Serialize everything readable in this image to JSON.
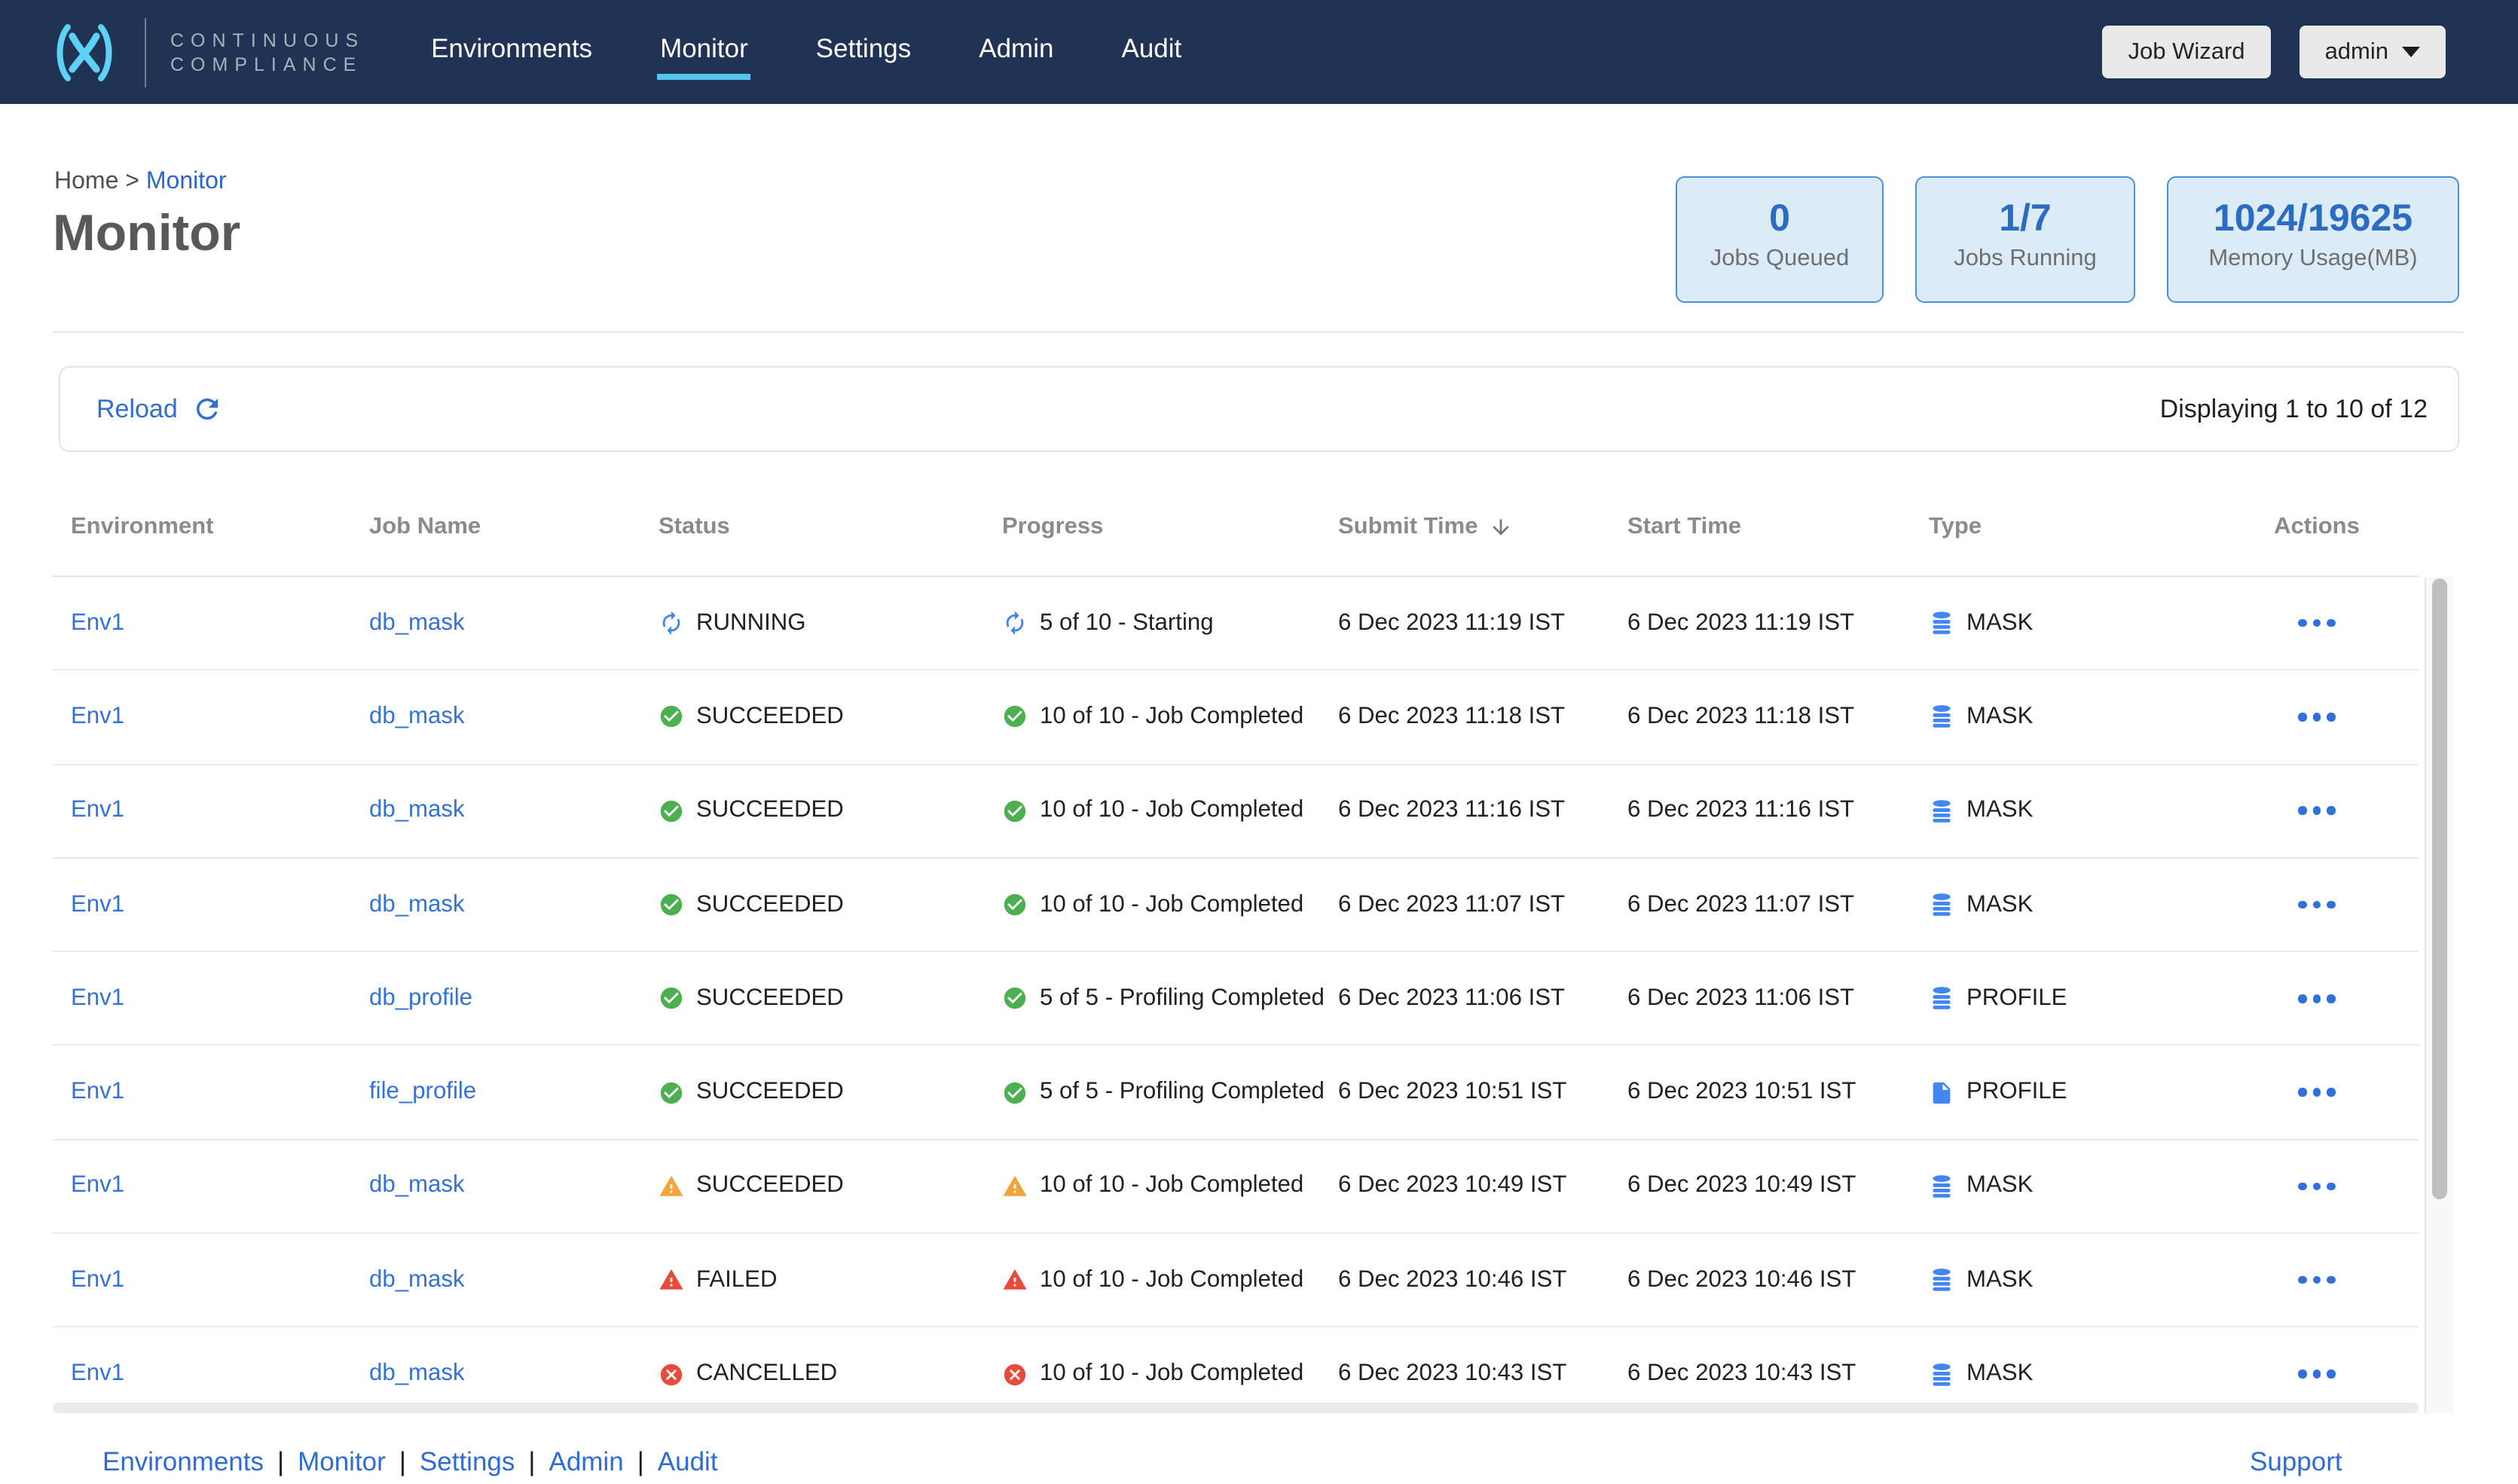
{
  "colors": {
    "header_bg": "#203354",
    "nav_active_underline": "#55c6e9",
    "logo_blue": "#5ed2f5",
    "link_blue": "#2f6fd4",
    "running_blue": "#4285f4",
    "success_green": "#4caf50",
    "warning_orange": "#f2a33c",
    "error_red": "#e84b3c",
    "type_icon_blue": "#4285f4",
    "sort_arrow_gray": "#757575"
  },
  "header": {
    "brand_line1": "CONTINUOUS",
    "brand_line2": "COMPLIANCE",
    "nav": [
      {
        "label": "Environments",
        "active": false
      },
      {
        "label": "Monitor",
        "active": true
      },
      {
        "label": "Settings",
        "active": false
      },
      {
        "label": "Admin",
        "active": false
      },
      {
        "label": "Audit",
        "active": false
      }
    ],
    "job_wizard_label": "Job Wizard",
    "user_menu_label": "admin"
  },
  "breadcrumb": {
    "home": "Home",
    "separator": ">",
    "current": "Monitor"
  },
  "page_title": "Monitor",
  "stats": [
    {
      "value": "0",
      "label": "Jobs Queued",
      "width": 138
    },
    {
      "value": "1/7",
      "label": "Jobs Running",
      "width": 146
    },
    {
      "value": "1024/19625",
      "label": "Memory Usage(MB)",
      "width": 194
    }
  ],
  "toolbar": {
    "reload_label": "Reload",
    "displaying_text": "Displaying 1 to 10 of 12"
  },
  "table": {
    "columns": [
      {
        "label": "Environment"
      },
      {
        "label": "Job Name"
      },
      {
        "label": "Status"
      },
      {
        "label": "Progress"
      },
      {
        "label": "Submit Time",
        "sorted": "desc"
      },
      {
        "label": "Start Time"
      },
      {
        "label": "Type"
      },
      {
        "label": "Actions",
        "center": true
      }
    ],
    "rows": [
      {
        "environment": "Env1",
        "job_name": "db_mask",
        "status": {
          "icon": "running-spinner-icon",
          "label": "RUNNING"
        },
        "progress": {
          "icon": "running-spinner-icon",
          "label": "5 of 10 - Starting"
        },
        "submit_time": "6 Dec 2023 11:19 IST",
        "start_time": "6 Dec 2023 11:19 IST",
        "type": {
          "icon": "database-icon",
          "label": "MASK"
        }
      },
      {
        "environment": "Env1",
        "job_name": "db_mask",
        "status": {
          "icon": "success-check-icon",
          "label": "SUCCEEDED"
        },
        "progress": {
          "icon": "success-check-icon",
          "label": "10 of 10 - Job Completed"
        },
        "submit_time": "6 Dec 2023 11:18 IST",
        "start_time": "6 Dec 2023 11:18 IST",
        "type": {
          "icon": "database-icon",
          "label": "MASK"
        }
      },
      {
        "environment": "Env1",
        "job_name": "db_mask",
        "status": {
          "icon": "success-check-icon",
          "label": "SUCCEEDED"
        },
        "progress": {
          "icon": "success-check-icon",
          "label": "10 of 10 - Job Completed"
        },
        "submit_time": "6 Dec 2023 11:16 IST",
        "start_time": "6 Dec 2023 11:16 IST",
        "type": {
          "icon": "database-icon",
          "label": "MASK"
        }
      },
      {
        "environment": "Env1",
        "job_name": "db_mask",
        "status": {
          "icon": "success-check-icon",
          "label": "SUCCEEDED"
        },
        "progress": {
          "icon": "success-check-icon",
          "label": "10 of 10 - Job Completed"
        },
        "submit_time": "6 Dec 2023 11:07 IST",
        "start_time": "6 Dec 2023 11:07 IST",
        "type": {
          "icon": "database-icon",
          "label": "MASK"
        }
      },
      {
        "environment": "Env1",
        "job_name": "db_profile",
        "status": {
          "icon": "success-check-icon",
          "label": "SUCCEEDED"
        },
        "progress": {
          "icon": "success-check-icon",
          "label": "5 of 5 - Profiling Completed"
        },
        "submit_time": "6 Dec 2023 11:06 IST",
        "start_time": "6 Dec 2023 11:06 IST",
        "type": {
          "icon": "database-icon",
          "label": "PROFILE"
        }
      },
      {
        "environment": "Env1",
        "job_name": "file_profile",
        "status": {
          "icon": "success-check-icon",
          "label": "SUCCEEDED"
        },
        "progress": {
          "icon": "success-check-icon",
          "label": "5 of 5 - Profiling Completed"
        },
        "submit_time": "6 Dec 2023 10:51 IST",
        "start_time": "6 Dec 2023 10:51 IST",
        "type": {
          "icon": "file-icon",
          "label": "PROFILE"
        }
      },
      {
        "environment": "Env1",
        "job_name": "db_mask",
        "status": {
          "icon": "warning-triangle-icon",
          "label": "SUCCEEDED"
        },
        "progress": {
          "icon": "warning-triangle-icon",
          "label": "10 of 10 - Job Completed"
        },
        "submit_time": "6 Dec 2023 10:49 IST",
        "start_time": "6 Dec 2023 10:49 IST",
        "type": {
          "icon": "database-icon",
          "label": "MASK"
        }
      },
      {
        "environment": "Env1",
        "job_name": "db_mask",
        "status": {
          "icon": "failed-triangle-icon",
          "label": "FAILED"
        },
        "progress": {
          "icon": "failed-triangle-icon",
          "label": "10 of 10 - Job Completed"
        },
        "submit_time": "6 Dec 2023 10:46 IST",
        "start_time": "6 Dec 2023 10:46 IST",
        "type": {
          "icon": "database-icon",
          "label": "MASK"
        }
      },
      {
        "environment": "Env1",
        "job_name": "db_mask",
        "status": {
          "icon": "cancelled-cross-icon",
          "label": "CANCELLED"
        },
        "progress": {
          "icon": "cancelled-cross-icon",
          "label": "10 of 10 - Job Completed"
        },
        "submit_time": "6 Dec 2023 10:43 IST",
        "start_time": "6 Dec 2023 10:43 IST",
        "type": {
          "icon": "database-icon",
          "label": "MASK"
        }
      }
    ]
  },
  "footer": {
    "links": [
      "Environments",
      "Monitor",
      "Settings",
      "Admin",
      "Audit"
    ],
    "separator": "|",
    "support_label": "Support"
  }
}
